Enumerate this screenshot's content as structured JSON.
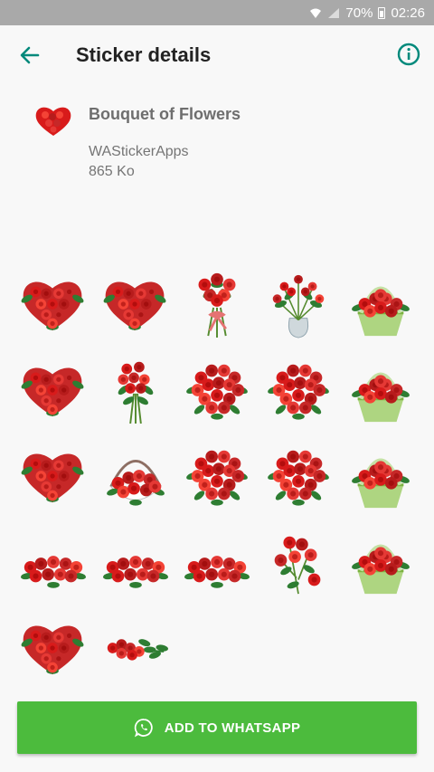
{
  "status_bar": {
    "battery": "70%",
    "time": "02:26"
  },
  "app_bar": {
    "title": "Sticker details",
    "back_icon": "arrow-left-icon",
    "info_icon": "info-icon"
  },
  "pack": {
    "name": "Bouquet of Flowers",
    "publisher": "WAStickerApps",
    "size": "865 Ko"
  },
  "stickers": [
    {
      "kind": "heart-roses"
    },
    {
      "kind": "heart-roses"
    },
    {
      "kind": "bouquet-ribbon"
    },
    {
      "kind": "vase-roses"
    },
    {
      "kind": "basket-roses"
    },
    {
      "kind": "heart-roses"
    },
    {
      "kind": "bouquet-tall"
    },
    {
      "kind": "bouquet-round"
    },
    {
      "kind": "bouquet-round"
    },
    {
      "kind": "basket-roses"
    },
    {
      "kind": "heart-roses"
    },
    {
      "kind": "basket-handle"
    },
    {
      "kind": "bouquet-round"
    },
    {
      "kind": "bouquet-round"
    },
    {
      "kind": "basket-roses"
    },
    {
      "kind": "roses-row"
    },
    {
      "kind": "roses-row"
    },
    {
      "kind": "roses-row"
    },
    {
      "kind": "roses-branch"
    },
    {
      "kind": "basket-roses"
    },
    {
      "kind": "heart-roses"
    },
    {
      "kind": "roses-lying"
    }
  ],
  "colors": {
    "accent": "#00897b",
    "button": "#4cbb3d",
    "rose": "#d81b1b",
    "leaf": "#2e7d32"
  },
  "add_button": {
    "label": "ADD TO WHATSAPP",
    "icon": "whatsapp-icon"
  }
}
